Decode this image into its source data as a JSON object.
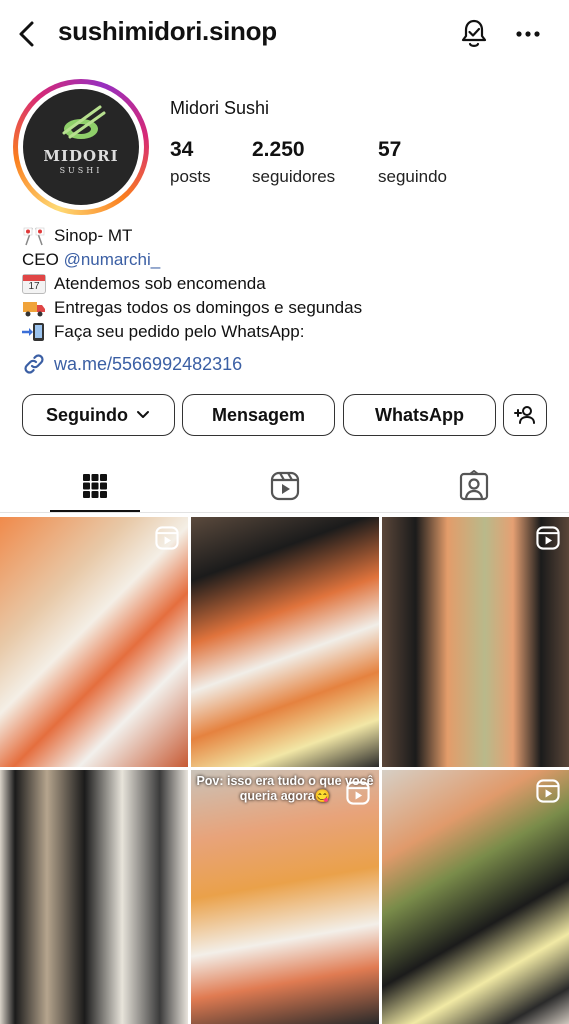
{
  "header": {
    "username": "sushimidori.sinop"
  },
  "profile": {
    "display_name": "Midori Sushi",
    "logo_line1": "MIDORI",
    "logo_line2": "SUSHI",
    "stats": [
      {
        "number": "34",
        "label": "posts"
      },
      {
        "number": "2.250",
        "label": "seguidores"
      },
      {
        "number": "57",
        "label": "seguindo"
      }
    ]
  },
  "bio": {
    "line1": "Sinop- MT",
    "line2_prefix": "CEO ",
    "line2_mention": "@numarchi_",
    "line3": "Atendemos sob encomenda",
    "calendar_day": "17",
    "line4": "Entregas todos os domingos e segundas",
    "line5": "Faça seu pedido pelo WhatsApp:",
    "link": "wa.me/5566992482316"
  },
  "buttons": {
    "following": "Seguindo",
    "message": "Mensagem",
    "whatsapp": "WhatsApp"
  },
  "tabs": [
    {
      "name": "grid",
      "icon": "grid-icon",
      "active": true
    },
    {
      "name": "reels",
      "icon": "reels-icon",
      "active": false
    },
    {
      "name": "tagged",
      "icon": "tagged-icon",
      "active": false
    }
  ],
  "posts": [
    {
      "type": "reel",
      "caption": ""
    },
    {
      "type": "photo",
      "caption": ""
    },
    {
      "type": "reel",
      "caption": ""
    },
    {
      "type": "photo",
      "caption": ""
    },
    {
      "type": "reel",
      "caption": "Pov: isso era tudo o que você queria agora😋"
    },
    {
      "type": "reel",
      "caption": ""
    }
  ],
  "colors": {
    "link": "#3b5fa4",
    "text": "#111111",
    "border": "#333333"
  }
}
